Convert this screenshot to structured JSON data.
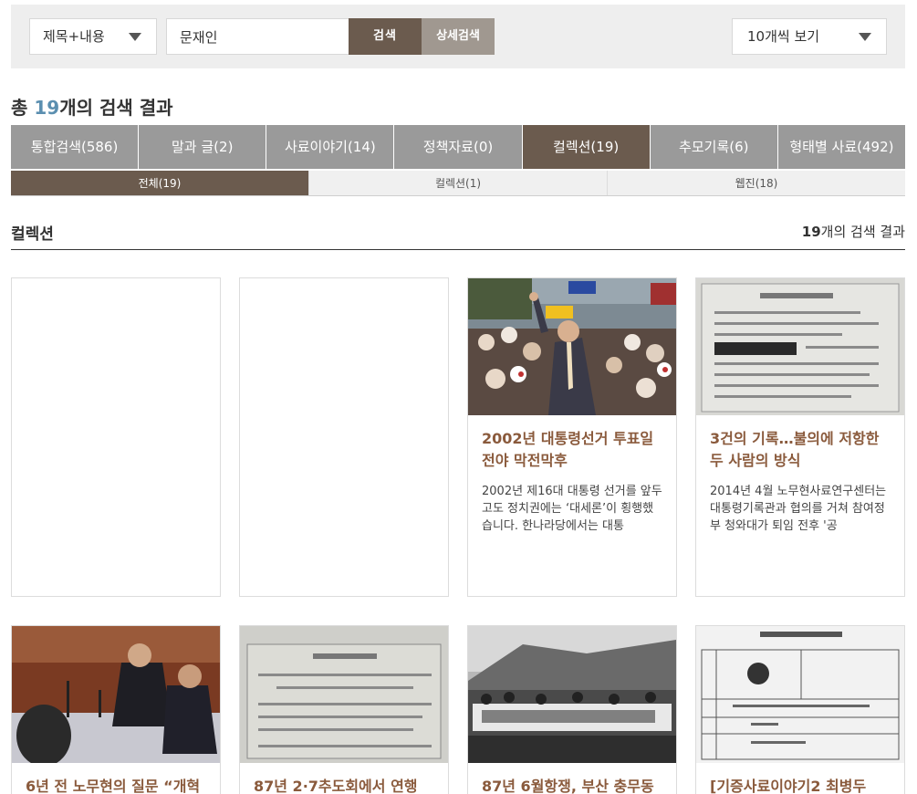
{
  "search": {
    "field_select": "제목+내용",
    "query": "문재인",
    "search_button": "검색",
    "detail_button": "상세검색",
    "per_page": "10개씩 보기"
  },
  "summary": {
    "prefix": "총",
    "count": "19",
    "suffix": "개의 검색 결과"
  },
  "main_tabs": [
    {
      "label": "통합검색(586)"
    },
    {
      "label": "말과 글(2)"
    },
    {
      "label": "사료이야기(14)"
    },
    {
      "label": "정책자료(0)"
    },
    {
      "label": "컬렉션(19)"
    },
    {
      "label": "추모기록(6)"
    },
    {
      "label": "형태별 사료(492)"
    }
  ],
  "sub_tabs": [
    {
      "label": "전체(19)"
    },
    {
      "label": "컬렉션(1)"
    },
    {
      "label": "웹진(18)"
    }
  ],
  "section": {
    "title": "컬렉션",
    "count": "19",
    "count_suffix": "개의 검색 결과"
  },
  "cards": [
    {
      "title": "",
      "desc": ""
    },
    {
      "title": "",
      "desc": ""
    },
    {
      "title": "2002년 대통령선거 투표일 전야 막전막후",
      "desc": "2002년 제16대 대통령 선거를 앞두고도 정치권에는 ‘대세론’이 횡행했습니다. 한나라당에서는 대통"
    },
    {
      "title": "3건의 기록…불의에 저항한 두 사람의 방식",
      "desc": "2014년 4월 노무현사료연구센터는 대통령기록관과 협의를 거쳐 참여정부 청와대가 퇴임 전후 '공"
    },
    {
      "title": "6년 전 노무현의 질문 “개혁",
      "desc": ""
    },
    {
      "title": "87년 2·7추도회에서 연행",
      "desc": ""
    },
    {
      "title": "87년 6월항쟁, 부산 충무동",
      "desc": ""
    },
    {
      "title": "[기증사료이야기2 최병두",
      "desc": ""
    }
  ],
  "colors": {
    "accent": "#6b5b4e",
    "tab_gray": "#9a9a9a",
    "count_blue": "#5b8fb0",
    "card_title": "#8a5a3c"
  }
}
